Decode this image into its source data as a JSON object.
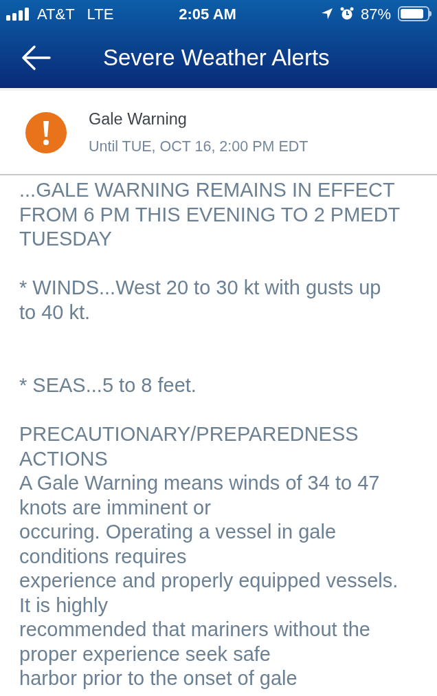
{
  "status_bar": {
    "carrier": "AT&T",
    "network": "LTE",
    "time": "2:05 AM",
    "battery": "87%"
  },
  "nav": {
    "title": "Severe Weather Alerts"
  },
  "alert": {
    "title": "Gale Warning",
    "until": "Until TUE, OCT 16, 2:00 PM EDT"
  },
  "body": "...GALE WARNING REMAINS IN EFFECT\nFROM 6 PM THIS EVENING TO 2 PMEDT\nTUESDAY\n\n* WINDS...West 20 to 30 kt with gusts up\nto 40 kt.\n\n\n* SEAS...5 to 8 feet.\n\nPRECAUTIONARY/PREPAREDNESS\nACTIONS\nA Gale Warning means winds of 34 to 47\nknots are imminent or\noccuring. Operating a vessel in gale\nconditions requires\nexperience and properly equipped vessels.\nIt is highly\nrecommended that mariners without the\nproper experience seek safe\nharbor prior to the onset of gale"
}
